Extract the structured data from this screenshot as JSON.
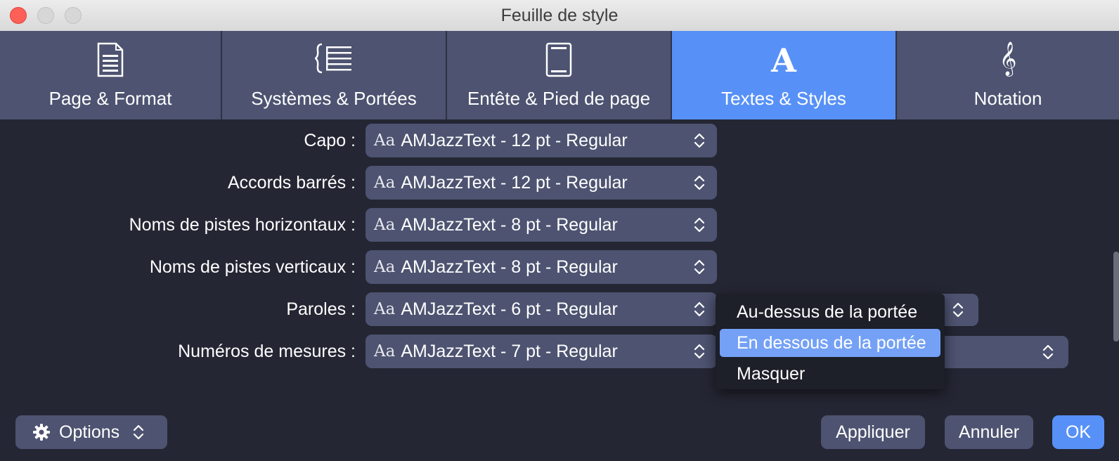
{
  "window": {
    "title": "Feuille de style"
  },
  "tabs": [
    {
      "label": "Page & Format",
      "icon": "page-icon"
    },
    {
      "label": "Systèmes & Portées",
      "icon": "staff-systems-icon"
    },
    {
      "label": "Entête & Pied de page",
      "icon": "header-footer-icon"
    },
    {
      "label": "Textes & Styles",
      "icon": "text-style-icon",
      "active": true
    },
    {
      "label": "Notation",
      "icon": "treble-clef-icon"
    }
  ],
  "rows": [
    {
      "label": "Capo :",
      "value": "AMJazzText - 12 pt - Regular",
      "prefix": "Aa"
    },
    {
      "label": "Accords barrés :",
      "value": "AMJazzText - 12 pt - Regular",
      "prefix": "Aa"
    },
    {
      "label": "Noms de pistes horizontaux :",
      "value": "AMJazzText - 8 pt - Regular",
      "prefix": "Aa"
    },
    {
      "label": "Noms de pistes verticaux :",
      "value": "AMJazzText - 8 pt - Regular",
      "prefix": "Aa"
    },
    {
      "label": "Paroles :",
      "value": "AMJazzText - 6 pt - Regular",
      "prefix": "Aa"
    },
    {
      "label": "Numéros de mesures :",
      "value": "AMJazzText - 7 pt - Regular",
      "prefix": "Aa"
    }
  ],
  "menu": {
    "items": [
      "Au-dessus de la portée",
      "En dessous de la portée",
      "Masquer"
    ],
    "selected": "En dessous de la portée"
  },
  "buttons": {
    "options": "Options",
    "apply": "Appliquer",
    "cancel": "Annuler",
    "ok": "OK"
  },
  "colors": {
    "background": "#242633",
    "tab": "#4d5370",
    "accent": "#5791f7",
    "menu_highlight": "#74a1f5",
    "close": "#fe5f57"
  }
}
